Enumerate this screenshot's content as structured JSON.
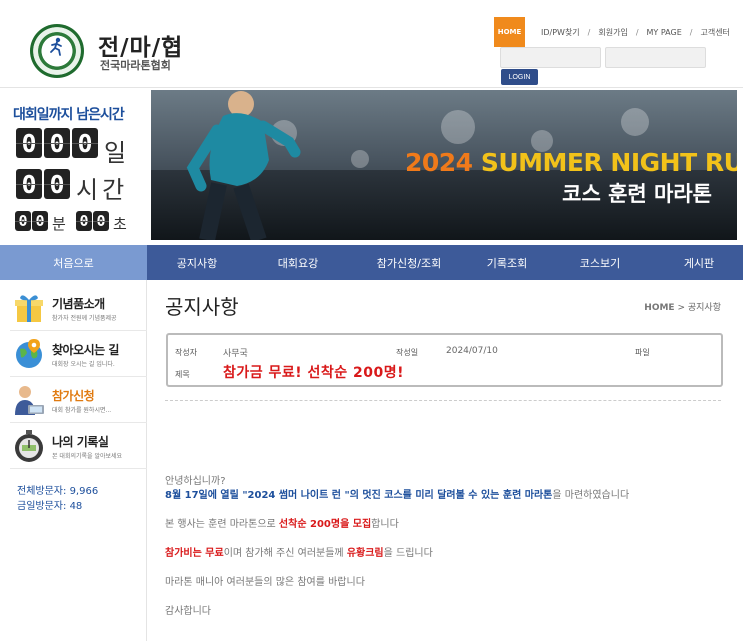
{
  "header": {
    "site_title": "전/마/협",
    "site_subtitle": "전국마라톤협회",
    "logo_icon": "association-emblem-icon",
    "topnav": {
      "home": "HOME",
      "links": [
        "ID/PW찾기",
        "회원가입",
        "MY PAGE",
        "고객센터"
      ],
      "separator": "/"
    },
    "login": {
      "id_placeholder": "",
      "pw_placeholder": "",
      "button": "LOGIN"
    }
  },
  "countdown": {
    "title": "대회일까지 남은시간",
    "days": [
      "0",
      "0",
      "0"
    ],
    "day_unit": "일",
    "hours": [
      "0",
      "0"
    ],
    "hour_unit": "시간",
    "minutes": [
      "0",
      "0"
    ],
    "minute_unit": "분",
    "seconds": [
      "0",
      "0"
    ],
    "second_unit": "초"
  },
  "banner": {
    "year": "2024",
    "line1": "SUMMER NIGHT RUN",
    "line2": "코스 훈련 마라톤"
  },
  "mainnav": {
    "first": "처음으로",
    "items": [
      "공지사항",
      "대회요강",
      "참가신청/조회",
      "기록조회",
      "코스보기",
      "게시판"
    ]
  },
  "sidebar": {
    "items": [
      {
        "title": "기념품소개",
        "desc": "참가자 전원께 기념품제공",
        "icon": "gift-box-icon",
        "highlight": false
      },
      {
        "title": "찾아오시는 길",
        "desc": "대회장 오시는 길 입니다.",
        "icon": "globe-icon",
        "highlight": false
      },
      {
        "title": "참가신청",
        "desc": "대회 참가를 원하시면...",
        "icon": "person-laptop-icon",
        "highlight": true
      },
      {
        "title": "나의 기록실",
        "desc": "본 대회의기록을 알아보세요",
        "icon": "stopwatch-icon",
        "highlight": false
      }
    ],
    "visitors": {
      "total_label": "전체방문자",
      "total": "9,966",
      "today_label": "금일방문자",
      "today": "48"
    }
  },
  "content": {
    "page_title": "공지사항",
    "breadcrumb": {
      "home": "HOME",
      "arrow": ">",
      "current": "공지사항"
    },
    "post": {
      "author_label": "작성자",
      "author": "사무국",
      "date_label": "작성일",
      "date": "2024/07/10",
      "file_label": "파일",
      "title_label": "제목",
      "title": "참가금 무료! 선착순 200명!"
    },
    "body": {
      "p1": "안녕하십니까?",
      "p2": [
        "8월 17일에 열릴 \"2024 썸머 나이트 런 \"의 멋진 코스를 미리 달려볼 수 있는 훈련 마라톤",
        "을 마련하였습니다"
      ],
      "p3": [
        "본 행사는 훈련 마라톤으로 ",
        "선착순 200명을 모집",
        "합니다"
      ],
      "p4": [
        "참가비는 무료",
        "이며 참가해 주신 여러분들께 ",
        "유황크림",
        "을 드립니다"
      ],
      "p5": "마라톤 매니아 여러분들의 많은 참여를 바랍니다",
      "p6": "감사합니다"
    }
  }
}
